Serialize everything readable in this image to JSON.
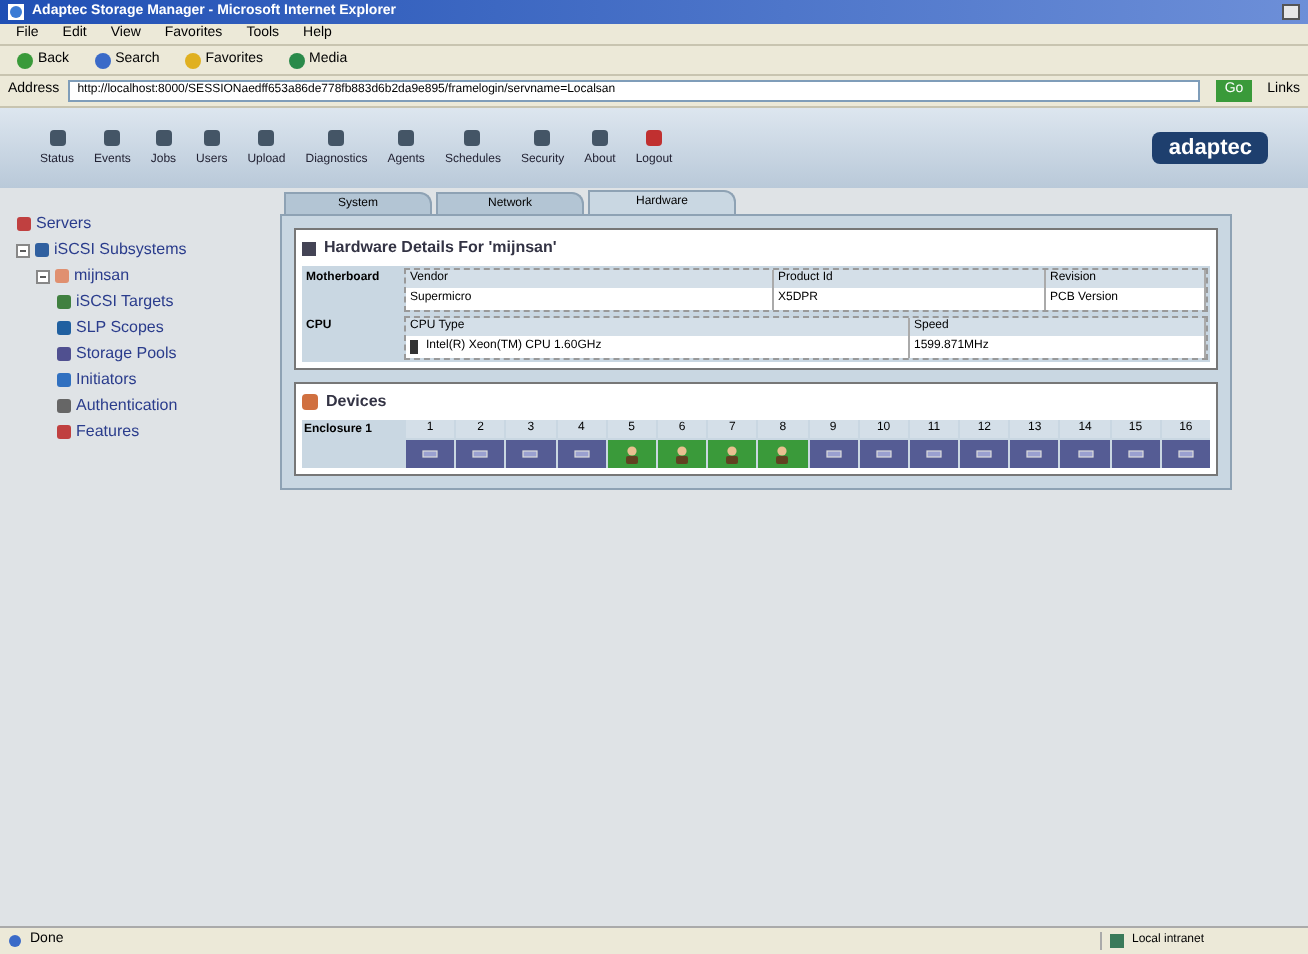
{
  "window": {
    "title": "Adaptec Storage Manager - Microsoft Internet Explorer"
  },
  "menu": [
    "File",
    "Edit",
    "View",
    "Favorites",
    "Tools",
    "Help"
  ],
  "toolbar": [
    "Back",
    "Search",
    "Favorites",
    "Media"
  ],
  "address": {
    "label": "Address",
    "value": "http://localhost:8000/SESSIONaedff653a86de778fb883d6b2da9e895/framelogin/servname=Localsan",
    "go": "Go",
    "links": "Links"
  },
  "app_toolbar": [
    "Status",
    "Events",
    "Jobs",
    "Users",
    "Upload",
    "Diagnostics",
    "Agents",
    "Schedules",
    "Security",
    "About",
    "Logout"
  ],
  "logo": "adaptec",
  "tree": [
    {
      "label": "Servers"
    },
    {
      "label": "iSCSI Subsystems",
      "expanded": true,
      "children": [
        {
          "label": "mijnsan",
          "expanded": true,
          "children": [
            {
              "label": "iSCSI Targets"
            },
            {
              "label": "SLP Scopes"
            },
            {
              "label": "Storage Pools"
            },
            {
              "label": "Initiators"
            },
            {
              "label": "Authentication"
            },
            {
              "label": "Features"
            }
          ]
        }
      ]
    }
  ],
  "tabs": [
    {
      "label": "System",
      "selected": false
    },
    {
      "label": "Network",
      "selected": false
    },
    {
      "label": "Hardware",
      "selected": true
    }
  ],
  "hardware": {
    "title": "Hardware Details For 'mijnsan'",
    "motherboard": {
      "label": "Motherboard",
      "columns": [
        "Vendor",
        "Product Id",
        "Revision"
      ],
      "values": [
        "Supermicro",
        "X5DPR",
        "PCB Version"
      ]
    },
    "cpu": {
      "label": "CPU",
      "columns": [
        "CPU Type",
        "Speed"
      ],
      "values": [
        "Intel(R) Xeon(TM) CPU 1.60GHz",
        "1599.871MHz"
      ]
    }
  },
  "devices": {
    "title": "Devices",
    "enclosure": "Enclosure 1",
    "slots": [
      {
        "number": "1",
        "kind": "empty"
      },
      {
        "number": "2",
        "kind": "empty"
      },
      {
        "number": "3",
        "kind": "empty"
      },
      {
        "number": "4",
        "kind": "empty"
      },
      {
        "number": "5",
        "kind": "drive"
      },
      {
        "number": "6",
        "kind": "drive"
      },
      {
        "number": "7",
        "kind": "drive"
      },
      {
        "number": "8",
        "kind": "drive"
      },
      {
        "number": "9",
        "kind": "empty"
      },
      {
        "number": "10",
        "kind": "empty"
      },
      {
        "number": "11",
        "kind": "empty"
      },
      {
        "number": "12",
        "kind": "empty"
      },
      {
        "number": "13",
        "kind": "empty"
      },
      {
        "number": "14",
        "kind": "empty"
      },
      {
        "number": "15",
        "kind": "empty"
      },
      {
        "number": "16",
        "kind": "empty"
      }
    ]
  },
  "status_bar": {
    "text": "Done",
    "zone": "Local intranet"
  }
}
